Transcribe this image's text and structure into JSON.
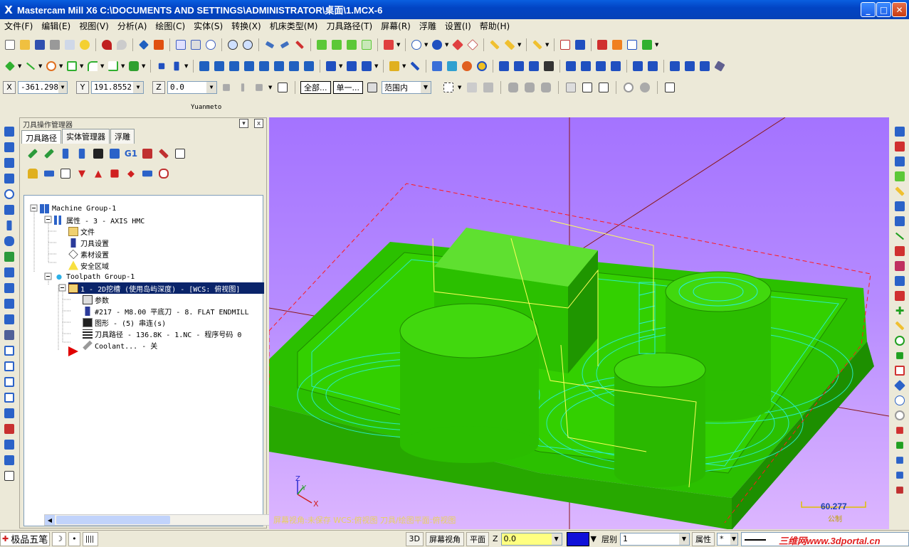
{
  "window": {
    "title": "Mastercam Mill X6  C:\\DOCUMENTS AND SETTINGS\\ADMINISTRATOR\\桌面\\1.MCX-6",
    "logo": "X",
    "min": "_",
    "max": "□",
    "close": "✕"
  },
  "menu": [
    "文件(F)",
    "编辑(E)",
    "视图(V)",
    "分析(A)",
    "绘图(C)",
    "实体(S)",
    "转换(X)",
    "机床类型(M)",
    "刀具路径(T)",
    "屏幕(R)",
    "浮雕",
    "设置(I)",
    "帮助(H)"
  ],
  "coords": {
    "x_label": "X",
    "x_value": "-361.298",
    "y_label": "Y",
    "y_value": "191.8552",
    "z_label": "Z",
    "z_value": "0.0",
    "all_button": "全部...",
    "single_button": "单一...",
    "range_select": "范围内"
  },
  "toolbar_caption": "Yuanmeto",
  "panel": {
    "title": "刀具操作管理器",
    "pin": "▾",
    "close": "x",
    "tabs": [
      "刀具路径",
      "实体管理器",
      "浮雕"
    ],
    "tree": {
      "machine_group": "Machine Group-1",
      "properties": "属性 - 3 - AXIS HMC",
      "files": "文件",
      "tool_settings": "刀具设置",
      "stock_setup": "素材设置",
      "safety_zone": "安全区域",
      "toolpath_group": "Toolpath Group-1",
      "operation": "1 - 2D挖槽 (使用岛屿深度) - [WCS: 俯视图]",
      "params": "参数",
      "tool": "#217 - M8.00 平底刀 -    8. FLAT ENDMILL",
      "geometry": "图形 - (5) 串连(s)",
      "toolpath": "刀具路径 - 136.8K - 1.NC - 程序号码 0",
      "coolant": "Coolant... - 关"
    }
  },
  "viewport": {
    "status_text": "屏幕视角:未保存   WCS:俯视图   刀具/绘图平面:俯视图",
    "scale_value": "60.277",
    "scale_unit": "公制",
    "axis_z": "Z",
    "axis_y": "Y",
    "axis_x": "X"
  },
  "statusbar": {
    "ime": "极品五笔",
    "ime_moon": "☽",
    "ime_dots": "•",
    "btn_3d": "3D",
    "screen_view": "屏幕视角",
    "plane": "平面",
    "z_label": "Z",
    "z_value": "0.0",
    "level_label": "层别",
    "level_value": "1",
    "attr_label": "属性",
    "attr_star": "*",
    "watermark": "三维网www.3dportal.cn"
  },
  "colors": {
    "part_green": "#2fc800",
    "viewport_purple": "#b088ff",
    "toolpath_cyan": "#29f0d8",
    "toolpath_yellow": "#ffff5a"
  }
}
